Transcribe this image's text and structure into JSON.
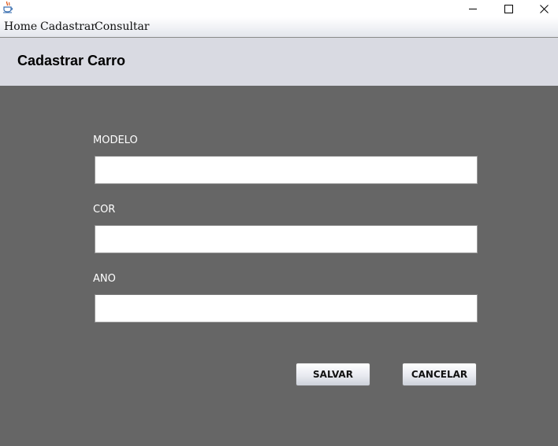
{
  "window": {
    "icon": "java-cup-icon",
    "controls": [
      "minimize-icon",
      "maximize-icon",
      "close-icon"
    ]
  },
  "menubar": {
    "items": [
      {
        "label": "Home"
      },
      {
        "label": "Cadastrar"
      },
      {
        "label": "Consultar"
      }
    ]
  },
  "header": {
    "title": "Cadastrar Carro"
  },
  "form": {
    "fields": [
      {
        "label": "MODELO",
        "value": "",
        "placeholder": ""
      },
      {
        "label": "COR",
        "value": "",
        "placeholder": ""
      },
      {
        "label": "ANO",
        "value": "",
        "placeholder": ""
      }
    ],
    "save_label": "SALVAR",
    "cancel_label": "CANCELAR"
  },
  "colors": {
    "header_bg": "#d9dae2",
    "content_bg": "#666666",
    "label_text": "#ffffff"
  }
}
